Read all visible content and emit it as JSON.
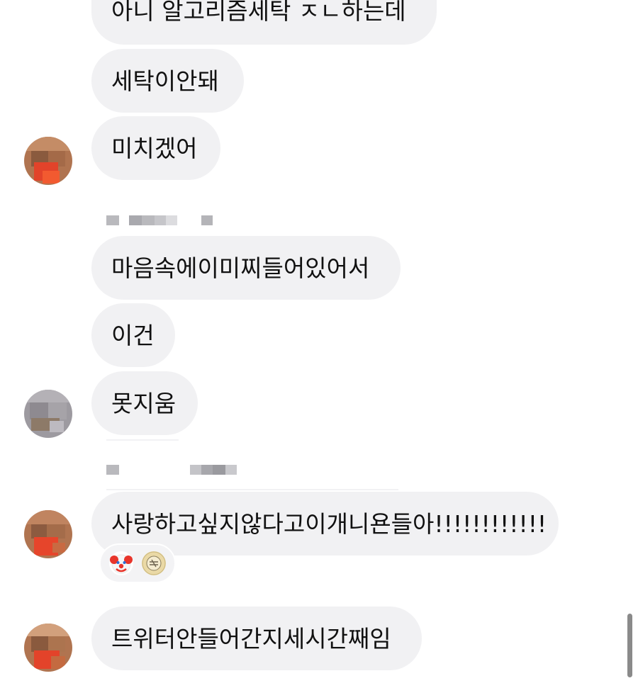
{
  "messages": [
    {
      "text": "아니 알고리즘세탁 ㅈㄴ하는데"
    },
    {
      "text": "세탁이안돼"
    },
    {
      "text": "미치겠어"
    },
    {
      "text": "마음속에이미찌들어있어서"
    },
    {
      "text": "이건"
    },
    {
      "text": "못지움"
    },
    {
      "text": "사랑하고싶지않다고이개니욘들아!!!!!!!!!!!!"
    },
    {
      "text": "트위터안들어간지세시간째임"
    }
  ],
  "reactions": [
    {
      "icon": "clown-face-icon"
    },
    {
      "icon": "sticker-badge-icon"
    }
  ],
  "colors": {
    "bubble": "#f1f1f3",
    "text": "#111111",
    "scrollbar": "#8a8a8a"
  }
}
